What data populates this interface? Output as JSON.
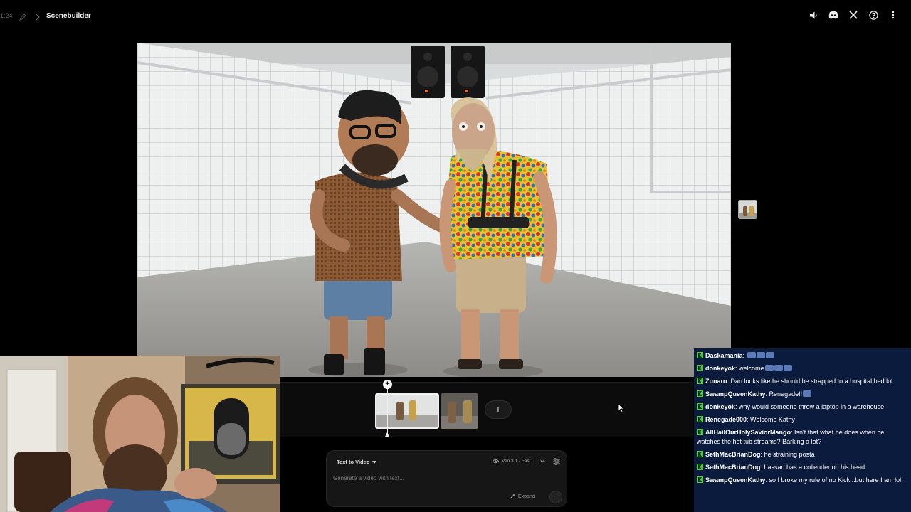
{
  "topbar": {
    "time": "1:24",
    "title": "Scenebuilder",
    "icons": [
      "speaker-icon",
      "discord-icon",
      "x-icon",
      "help-icon",
      "more-icon"
    ]
  },
  "timeline": {
    "add_symbol": "+",
    "playhead_symbol": "+"
  },
  "prompt": {
    "mode": "Text to Video",
    "model": "Veo 3.1 - Fast",
    "count": "x4",
    "placeholder": "Generate a video with text...",
    "expand_label": "Expand",
    "send_symbol": "→"
  },
  "chat": {
    "badge_color": "#4cd13d",
    "background": "#0b1b3d",
    "messages": [
      {
        "user": "Daskamania",
        "user_color": "#ffffff",
        "text": "",
        "emotes": 3
      },
      {
        "user": "donkeyok",
        "user_color": "#ffffff",
        "text": "welcome",
        "emotes": 3
      },
      {
        "user": "Zunaro",
        "user_color": "#ffffff",
        "text": "Dan looks like he should be strapped to a hospital bed lol",
        "emotes": 0
      },
      {
        "user": "SwampQueenKathy",
        "user_color": "#ffffff",
        "text": "Renegade!!",
        "emotes": 1
      },
      {
        "user": "donkeyok",
        "user_color": "#ffffff",
        "text": "why would someone throw a laptop in a warehouse",
        "emotes": 0
      },
      {
        "user": "Renegade000",
        "user_color": "#ffffff",
        "text": "Welcome Kathy",
        "emotes": 0
      },
      {
        "user": "AllHailOurHolySaviorMango",
        "user_color": "#ffffff",
        "text": "Isn't that what he does when he watches the hot tub streams? Barking a lot?",
        "emotes": 0
      },
      {
        "user": "SethMacBrianDog",
        "user_color": "#ffffff",
        "text": "he straining posta",
        "emotes": 0
      },
      {
        "user": "SethMacBrianDog",
        "user_color": "#ffffff",
        "text": "hassan has a collender on his head",
        "emotes": 0
      },
      {
        "user": "SwampQueenKathy",
        "user_color": "#ffffff",
        "text": "so I broke my rule of no Kick...but here I am lol",
        "emotes": 0
      }
    ]
  }
}
